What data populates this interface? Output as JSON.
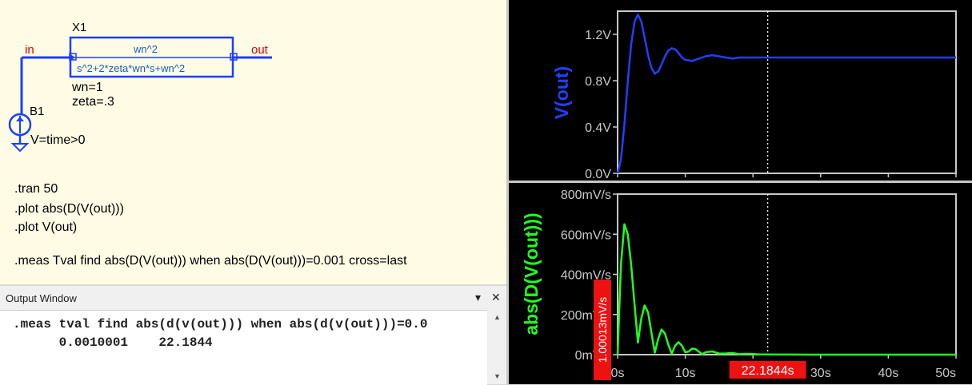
{
  "schematic": {
    "component_ref": "X1",
    "numerator": "wn^2",
    "denominator": "s^2+2*zeta*wn*s+wn^2",
    "params": [
      "wn=1",
      "zeta=.3"
    ],
    "net_in": "in",
    "net_out": "out",
    "source_ref": "B1",
    "source_value": "V=time>0",
    "directives": [
      ".tran 50",
      ".plot abs(D(V(out)))",
      ".plot V(out)"
    ],
    "meas_directive": ".meas Tval find abs(D(V(out))) when abs(D(V(out)))=0.001 cross=last"
  },
  "output_window": {
    "title": "Output Window",
    "pin_glyph": "▾",
    "close_glyph": "✕",
    "lines": [
      ".meas tval find abs(d(v(out))) when abs(d(v(out)))=0.0",
      "      0.0010001    22.1844"
    ]
  },
  "chart_data": [
    {
      "type": "line",
      "ylabel": "V(out)",
      "series": [
        {
          "name": "V(out)",
          "color": "#2040ff",
          "x": [
            0,
            0.5,
            1,
            1.5,
            2,
            2.5,
            3,
            3.5,
            4,
            4.5,
            5,
            5.5,
            6,
            6.5,
            7,
            7.5,
            8,
            8.5,
            9,
            9.5,
            10,
            11,
            12,
            13,
            14,
            15,
            16,
            17,
            18,
            19,
            20,
            22,
            24,
            26,
            28,
            30,
            35,
            40,
            45,
            50
          ],
          "y": [
            0,
            0.12,
            0.42,
            0.79,
            1.11,
            1.31,
            1.37,
            1.31,
            1.17,
            1.02,
            0.91,
            0.86,
            0.88,
            0.94,
            1.01,
            1.06,
            1.08,
            1.07,
            1.04,
            1.0,
            0.98,
            0.97,
            0.99,
            1.01,
            1.02,
            1.01,
            1.0,
            0.99,
            1.0,
            1.0,
            1.0,
            1.0,
            1.0,
            1.0,
            1.0,
            1.0,
            1.0,
            1.0,
            1.0,
            1.0
          ]
        }
      ],
      "yticks": [
        "0.0V",
        "0.4V",
        "0.8V",
        "1.2V"
      ],
      "ytick_values": [
        0,
        0.4,
        0.8,
        1.2
      ],
      "xlim": [
        0,
        50
      ],
      "ylim": [
        0,
        1.4
      ],
      "cursor_x": 22.1844
    },
    {
      "type": "line",
      "ylabel": "abs(D(V(out)))",
      "series": [
        {
          "name": "abs(D(V(out)))",
          "color": "#20ff20",
          "x": [
            0,
            0.5,
            1,
            1.5,
            2,
            2.5,
            3,
            3.5,
            4,
            4.5,
            5,
            5.5,
            6,
            6.5,
            7,
            7.5,
            8,
            8.5,
            9,
            9.5,
            10,
            10.5,
            11,
            11.5,
            12,
            12.5,
            13,
            14,
            15,
            16,
            17,
            18,
            19,
            20,
            21,
            22,
            24,
            26,
            28,
            30,
            35,
            40,
            45,
            50
          ],
          "y": [
            0,
            450,
            650,
            600,
            450,
            250,
            60,
            180,
            245,
            210,
            110,
            10,
            80,
            125,
            105,
            50,
            5,
            45,
            62,
            45,
            12,
            15,
            30,
            28,
            15,
            2,
            12,
            16,
            5,
            6,
            8,
            2,
            4,
            3,
            1,
            1,
            0.5,
            0.3,
            0.1,
            0.05,
            0,
            0,
            0,
            0
          ]
        }
      ],
      "yticks": [
        "0mV/s",
        "200mV/s",
        "400mV/s",
        "600mV/s",
        "800mV/s"
      ],
      "ytick_values": [
        0,
        200,
        400,
        600,
        800
      ],
      "xticks": [
        "0s",
        "10s",
        "20s",
        "30s",
        "40s",
        "50s"
      ],
      "xtick_values": [
        0,
        10,
        20,
        30,
        40,
        50
      ],
      "xlim": [
        0,
        50
      ],
      "ylim": [
        0,
        800
      ],
      "cursor_x": 22.1844,
      "cursor_x_label": "22.1844s",
      "cursor_y_label": "1.00013mV/s"
    }
  ],
  "colors": {
    "schematic_bg": "#fffbe5",
    "wire": "#1a40ff",
    "net_label": "#e00000",
    "plot_bg": "#000000",
    "axis_box": "#c8c8c8",
    "marker_bg": "#ee1111"
  }
}
